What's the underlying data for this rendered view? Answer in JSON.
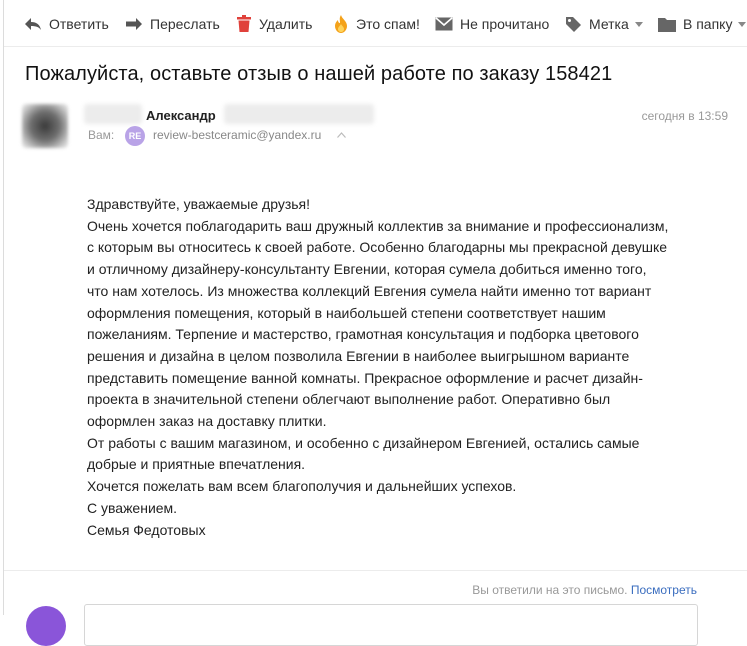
{
  "toolbar": {
    "reply": "Ответить",
    "forward": "Переслать",
    "delete": "Удалить",
    "spam": "Это спам!",
    "unread": "Не прочитано",
    "label": "Метка",
    "folder": "В папку"
  },
  "message": {
    "subject": "Пожалуйста, оставьте отзыв о нашей работе по заказу 158421",
    "sender_name": "Александр",
    "to_label": "Вам:",
    "to_badge": "RE",
    "to_email": "review-bestceramic@yandex.ru",
    "date": "сегодня в 13:59",
    "body_lines": [
      "Здравствуйте, уважаемые друзья!",
      "Очень хочется поблагодарить ваш дружный коллектив за внимание и профессионализм,",
      "с которым вы относитесь к своей работе. Особенно благодарны мы прекрасной девушке",
      "и отличному дизайнеру-консультанту Евгении, которая сумела добиться именно того,",
      "что нам хотелось. Из множества коллекций Евгения сумела найти именно тот вариант",
      "оформления помещения, который в наибольшей степени соответствует нашим",
      "пожеланиям. Терпение и мастерство, грамотная консультация и подборка цветового",
      "решения и дизайна в целом позволила Евгении в наиболее выигрышном варианте",
      "представить помещение ванной комнаты. Прекрасное оформление и расчет дизайн-",
      "проекта в значительной степени облегчают выполнение работ. Оперативно был",
      "оформлен заказ на доставку плитки.",
      "От работы с вашим магазином, и особенно с дизайнером Евгенией, остались самые",
      "добрые и приятные впечатления.",
      "Хочется пожелать вам всем благополучия и дальнейших успехов.",
      "С уважением.",
      "Семья Федотовых"
    ]
  },
  "footer": {
    "replied_text": "Вы ответили на это письмо.",
    "view_link": "Посмотреть"
  },
  "colors": {
    "accent_link": "#3a6dbf",
    "spam_flame": "#f4a21a",
    "delete_red": "#e0413b",
    "badge_purple": "#b9a3e7",
    "user_avatar": "#8a55d9"
  },
  "icons": [
    "reply-icon",
    "forward-icon",
    "trash-icon",
    "flame-icon",
    "envelope-icon",
    "tag-icon",
    "folder-icon",
    "chevron-down-icon",
    "chevron-up-icon"
  ]
}
